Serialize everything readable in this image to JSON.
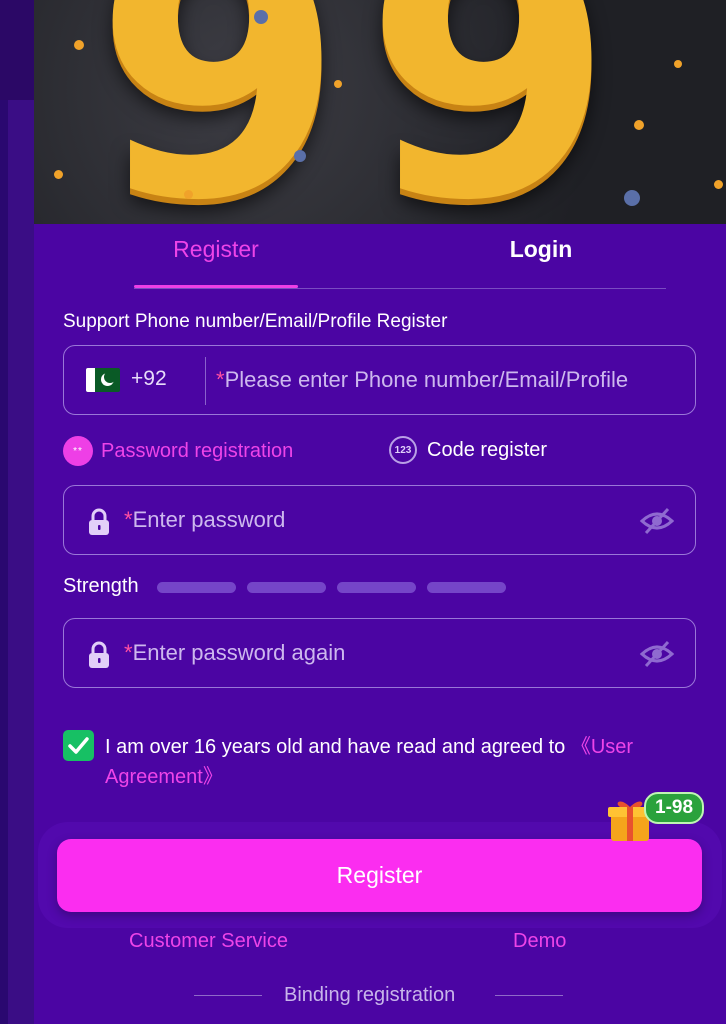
{
  "banner": {
    "digits": "99"
  },
  "tabs": [
    {
      "label": "Register",
      "active": true
    },
    {
      "label": "Login",
      "active": false
    }
  ],
  "form": {
    "support_label": "Support Phone number/Email/Profile Register",
    "country_code": "+92",
    "phone_placeholder": "Please enter Phone number/Email/Profile",
    "required_mark": "*",
    "modes": {
      "password": {
        "label": "Password registration",
        "icon": "**",
        "selected": true
      },
      "code": {
        "label": "Code register",
        "icon": "123",
        "selected": false
      }
    },
    "password_placeholder": "Enter password",
    "strength_label": "Strength",
    "password_again_placeholder": "Enter password again",
    "agreement_text": "I am over 16 years old and have read and agreed to ",
    "agreement_link": "《User Agreement》",
    "agreement_checked": true
  },
  "actions": {
    "register_label": "Register",
    "gift_badge": "1-98",
    "customer_service": "Customer Service",
    "demo": "Demo",
    "binding_registration": "Binding registration"
  },
  "colors": {
    "panel_bg": "#4b05a3",
    "accent_pink": "#ee44e8",
    "register_button": "#fb2df0",
    "checkbox_green": "#17c064"
  }
}
